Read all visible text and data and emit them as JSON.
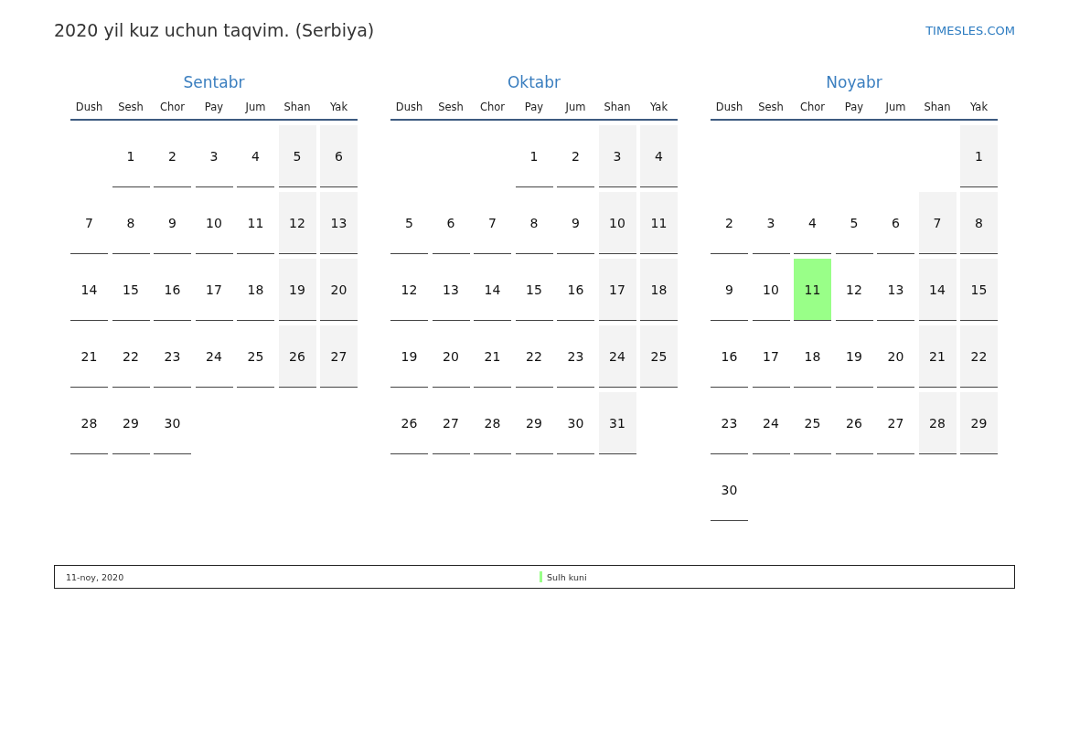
{
  "title": "2020 yil kuz uchun taqvim. (Serbiya)",
  "site_link": "TIMESLES.COM",
  "months": [
    {
      "name": "Sentabr",
      "weekdays": [
        "Dush",
        "Sesh",
        "Chor",
        "Pay",
        "Jum",
        "Shan",
        "Yak"
      ],
      "weeks": [
        [
          {
            "kind": "blank"
          },
          {
            "kind": "day",
            "day": "1",
            "weekend": false,
            "holiday": false
          },
          {
            "kind": "day",
            "day": "2",
            "weekend": false,
            "holiday": false
          },
          {
            "kind": "day",
            "day": "3",
            "weekend": false,
            "holiday": false
          },
          {
            "kind": "day",
            "day": "4",
            "weekend": false,
            "holiday": false
          },
          {
            "kind": "day",
            "day": "5",
            "weekend": true,
            "holiday": false
          },
          {
            "kind": "day",
            "day": "6",
            "weekend": true,
            "holiday": false
          }
        ],
        [
          {
            "kind": "day",
            "day": "7",
            "weekend": false,
            "holiday": false
          },
          {
            "kind": "day",
            "day": "8",
            "weekend": false,
            "holiday": false
          },
          {
            "kind": "day",
            "day": "9",
            "weekend": false,
            "holiday": false
          },
          {
            "kind": "day",
            "day": "10",
            "weekend": false,
            "holiday": false
          },
          {
            "kind": "day",
            "day": "11",
            "weekend": false,
            "holiday": false
          },
          {
            "kind": "day",
            "day": "12",
            "weekend": true,
            "holiday": false
          },
          {
            "kind": "day",
            "day": "13",
            "weekend": true,
            "holiday": false
          }
        ],
        [
          {
            "kind": "day",
            "day": "14",
            "weekend": false,
            "holiday": false
          },
          {
            "kind": "day",
            "day": "15",
            "weekend": false,
            "holiday": false
          },
          {
            "kind": "day",
            "day": "16",
            "weekend": false,
            "holiday": false
          },
          {
            "kind": "day",
            "day": "17",
            "weekend": false,
            "holiday": false
          },
          {
            "kind": "day",
            "day": "18",
            "weekend": false,
            "holiday": false
          },
          {
            "kind": "day",
            "day": "19",
            "weekend": true,
            "holiday": false
          },
          {
            "kind": "day",
            "day": "20",
            "weekend": true,
            "holiday": false
          }
        ],
        [
          {
            "kind": "day",
            "day": "21",
            "weekend": false,
            "holiday": false
          },
          {
            "kind": "day",
            "day": "22",
            "weekend": false,
            "holiday": false
          },
          {
            "kind": "day",
            "day": "23",
            "weekend": false,
            "holiday": false
          },
          {
            "kind": "day",
            "day": "24",
            "weekend": false,
            "holiday": false
          },
          {
            "kind": "day",
            "day": "25",
            "weekend": false,
            "holiday": false
          },
          {
            "kind": "day",
            "day": "26",
            "weekend": true,
            "holiday": false
          },
          {
            "kind": "day",
            "day": "27",
            "weekend": true,
            "holiday": false
          }
        ],
        [
          {
            "kind": "day",
            "day": "28",
            "weekend": false,
            "holiday": false
          },
          {
            "kind": "day",
            "day": "29",
            "weekend": false,
            "holiday": false
          },
          {
            "kind": "day",
            "day": "30",
            "weekend": false,
            "holiday": false
          },
          {
            "kind": "blank"
          },
          {
            "kind": "blank"
          },
          {
            "kind": "blank"
          },
          {
            "kind": "blank"
          }
        ]
      ]
    },
    {
      "name": "Oktabr",
      "weekdays": [
        "Dush",
        "Sesh",
        "Chor",
        "Pay",
        "Jum",
        "Shan",
        "Yak"
      ],
      "weeks": [
        [
          {
            "kind": "blank"
          },
          {
            "kind": "blank"
          },
          {
            "kind": "blank"
          },
          {
            "kind": "day",
            "day": "1",
            "weekend": false,
            "holiday": false
          },
          {
            "kind": "day",
            "day": "2",
            "weekend": false,
            "holiday": false
          },
          {
            "kind": "day",
            "day": "3",
            "weekend": true,
            "holiday": false
          },
          {
            "kind": "day",
            "day": "4",
            "weekend": true,
            "holiday": false
          }
        ],
        [
          {
            "kind": "day",
            "day": "5",
            "weekend": false,
            "holiday": false
          },
          {
            "kind": "day",
            "day": "6",
            "weekend": false,
            "holiday": false
          },
          {
            "kind": "day",
            "day": "7",
            "weekend": false,
            "holiday": false
          },
          {
            "kind": "day",
            "day": "8",
            "weekend": false,
            "holiday": false
          },
          {
            "kind": "day",
            "day": "9",
            "weekend": false,
            "holiday": false
          },
          {
            "kind": "day",
            "day": "10",
            "weekend": true,
            "holiday": false
          },
          {
            "kind": "day",
            "day": "11",
            "weekend": true,
            "holiday": false
          }
        ],
        [
          {
            "kind": "day",
            "day": "12",
            "weekend": false,
            "holiday": false
          },
          {
            "kind": "day",
            "day": "13",
            "weekend": false,
            "holiday": false
          },
          {
            "kind": "day",
            "day": "14",
            "weekend": false,
            "holiday": false
          },
          {
            "kind": "day",
            "day": "15",
            "weekend": false,
            "holiday": false
          },
          {
            "kind": "day",
            "day": "16",
            "weekend": false,
            "holiday": false
          },
          {
            "kind": "day",
            "day": "17",
            "weekend": true,
            "holiday": false
          },
          {
            "kind": "day",
            "day": "18",
            "weekend": true,
            "holiday": false
          }
        ],
        [
          {
            "kind": "day",
            "day": "19",
            "weekend": false,
            "holiday": false
          },
          {
            "kind": "day",
            "day": "20",
            "weekend": false,
            "holiday": false
          },
          {
            "kind": "day",
            "day": "21",
            "weekend": false,
            "holiday": false
          },
          {
            "kind": "day",
            "day": "22",
            "weekend": false,
            "holiday": false
          },
          {
            "kind": "day",
            "day": "23",
            "weekend": false,
            "holiday": false
          },
          {
            "kind": "day",
            "day": "24",
            "weekend": true,
            "holiday": false
          },
          {
            "kind": "day",
            "day": "25",
            "weekend": true,
            "holiday": false
          }
        ],
        [
          {
            "kind": "day",
            "day": "26",
            "weekend": false,
            "holiday": false
          },
          {
            "kind": "day",
            "day": "27",
            "weekend": false,
            "holiday": false
          },
          {
            "kind": "day",
            "day": "28",
            "weekend": false,
            "holiday": false
          },
          {
            "kind": "day",
            "day": "29",
            "weekend": false,
            "holiday": false
          },
          {
            "kind": "day",
            "day": "30",
            "weekend": false,
            "holiday": false
          },
          {
            "kind": "day",
            "day": "31",
            "weekend": true,
            "holiday": false
          },
          {
            "kind": "blank"
          }
        ]
      ]
    },
    {
      "name": "Noyabr",
      "weekdays": [
        "Dush",
        "Sesh",
        "Chor",
        "Pay",
        "Jum",
        "Shan",
        "Yak"
      ],
      "weeks": [
        [
          {
            "kind": "blank"
          },
          {
            "kind": "blank"
          },
          {
            "kind": "blank"
          },
          {
            "kind": "blank"
          },
          {
            "kind": "blank"
          },
          {
            "kind": "blank"
          },
          {
            "kind": "day",
            "day": "1",
            "weekend": true,
            "holiday": false
          }
        ],
        [
          {
            "kind": "day",
            "day": "2",
            "weekend": false,
            "holiday": false
          },
          {
            "kind": "day",
            "day": "3",
            "weekend": false,
            "holiday": false
          },
          {
            "kind": "day",
            "day": "4",
            "weekend": false,
            "holiday": false
          },
          {
            "kind": "day",
            "day": "5",
            "weekend": false,
            "holiday": false
          },
          {
            "kind": "day",
            "day": "6",
            "weekend": false,
            "holiday": false
          },
          {
            "kind": "day",
            "day": "7",
            "weekend": true,
            "holiday": false
          },
          {
            "kind": "day",
            "day": "8",
            "weekend": true,
            "holiday": false
          }
        ],
        [
          {
            "kind": "day",
            "day": "9",
            "weekend": false,
            "holiday": false
          },
          {
            "kind": "day",
            "day": "10",
            "weekend": false,
            "holiday": false
          },
          {
            "kind": "day",
            "day": "11",
            "weekend": false,
            "holiday": true
          },
          {
            "kind": "day",
            "day": "12",
            "weekend": false,
            "holiday": false
          },
          {
            "kind": "day",
            "day": "13",
            "weekend": false,
            "holiday": false
          },
          {
            "kind": "day",
            "day": "14",
            "weekend": true,
            "holiday": false
          },
          {
            "kind": "day",
            "day": "15",
            "weekend": true,
            "holiday": false
          }
        ],
        [
          {
            "kind": "day",
            "day": "16",
            "weekend": false,
            "holiday": false
          },
          {
            "kind": "day",
            "day": "17",
            "weekend": false,
            "holiday": false
          },
          {
            "kind": "day",
            "day": "18",
            "weekend": false,
            "holiday": false
          },
          {
            "kind": "day",
            "day": "19",
            "weekend": false,
            "holiday": false
          },
          {
            "kind": "day",
            "day": "20",
            "weekend": false,
            "holiday": false
          },
          {
            "kind": "day",
            "day": "21",
            "weekend": true,
            "holiday": false
          },
          {
            "kind": "day",
            "day": "22",
            "weekend": true,
            "holiday": false
          }
        ],
        [
          {
            "kind": "day",
            "day": "23",
            "weekend": false,
            "holiday": false
          },
          {
            "kind": "day",
            "day": "24",
            "weekend": false,
            "holiday": false
          },
          {
            "kind": "day",
            "day": "25",
            "weekend": false,
            "holiday": false
          },
          {
            "kind": "day",
            "day": "26",
            "weekend": false,
            "holiday": false
          },
          {
            "kind": "day",
            "day": "27",
            "weekend": false,
            "holiday": false
          },
          {
            "kind": "day",
            "day": "28",
            "weekend": true,
            "holiday": false
          },
          {
            "kind": "day",
            "day": "29",
            "weekend": true,
            "holiday": false
          }
        ],
        [
          {
            "kind": "day",
            "day": "30",
            "weekend": false,
            "holiday": false
          },
          {
            "kind": "blank"
          },
          {
            "kind": "blank"
          },
          {
            "kind": "blank"
          },
          {
            "kind": "blank"
          },
          {
            "kind": "blank"
          },
          {
            "kind": "blank"
          }
        ]
      ]
    }
  ],
  "holidays": [
    {
      "date": "11-noy, 2020",
      "name": "Sulh kuni",
      "color": "#99ff88"
    }
  ]
}
